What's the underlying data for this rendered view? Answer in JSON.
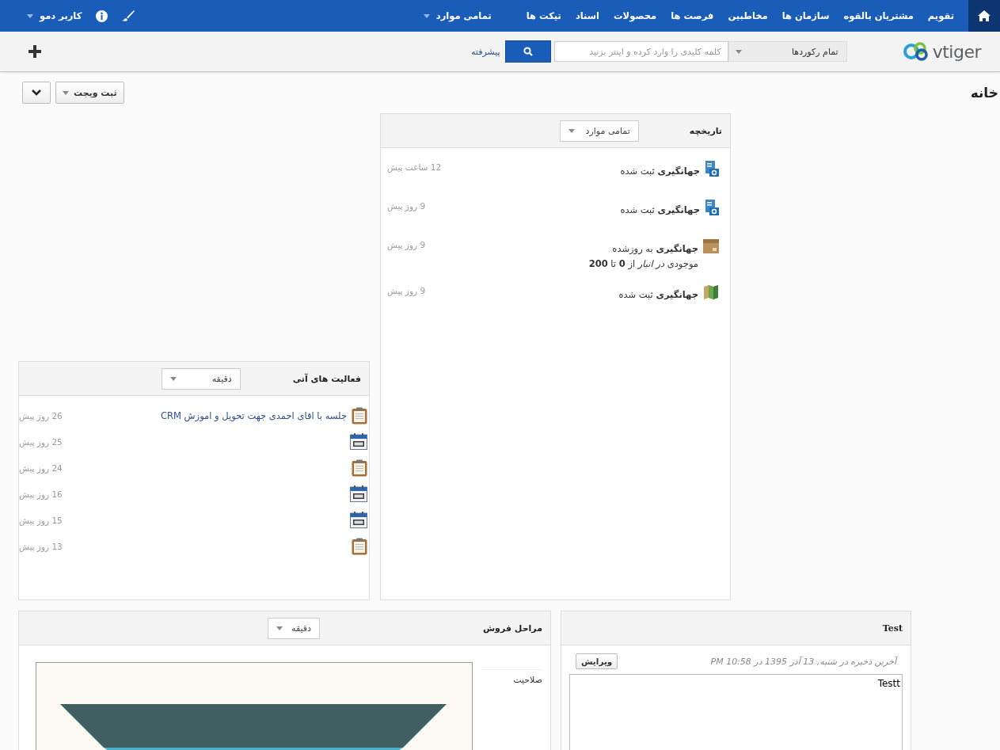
{
  "top_nav": {
    "items": [
      {
        "label": "تقویم"
      },
      {
        "label": "مشتریان بالقوه"
      },
      {
        "label": "سازمان ها"
      },
      {
        "label": "مخاطبین"
      },
      {
        "label": "فرصت ها"
      },
      {
        "label": "محصولات"
      },
      {
        "label": "اسناد"
      },
      {
        "label": "تیکت ها"
      }
    ],
    "more": "تمامی موارد",
    "user": "کاربر دمو"
  },
  "header": {
    "logo": "vtiger",
    "scope": "تمام رکوردها",
    "placeholder": "کلمه کلیدی را وارد کرده و اینتر بزنید",
    "advanced": "پیشرفته"
  },
  "page": {
    "title": "خانه",
    "add_widget": "ثبت ویجت"
  },
  "history": {
    "title": "تاریخچه",
    "filter": "تمامی موارد",
    "items": [
      {
        "kind": "sales_order",
        "name": "جهانگیری",
        "action": "ثبت شده",
        "time": "12 ساعت پیش"
      },
      {
        "kind": "quote",
        "name": "جهانگیری",
        "action": "ثبت شده",
        "time": "9 روز پیش"
      },
      {
        "kind": "product",
        "name": "جهانگیری",
        "action": "به روزشده",
        "detail": "موجودی *در انبار*  از **0** تا **200**",
        "time": "9 روز پیش"
      },
      {
        "kind": "book",
        "name": "جهانگیری",
        "action": "ثبت شده",
        "time": "9 روز پیش"
      }
    ]
  },
  "activities": {
    "title": "فعالیت های آتی",
    "filter": "دقیقه",
    "items": [
      {
        "kind": "task",
        "subject": "جلسه با اقای احمدی جهت تحویل و اموزش CRM",
        "time": "26 روز پیش"
      },
      {
        "kind": "event",
        "time": "25 روز پیش"
      },
      {
        "kind": "task",
        "time": "24 روز پیش"
      },
      {
        "kind": "event",
        "time": "16 روز پیش"
      },
      {
        "kind": "event",
        "time": "15 روز پیش"
      },
      {
        "kind": "task",
        "time": "13 روز پیش"
      }
    ]
  },
  "sales_stages": {
    "title": "مراحل فروش",
    "filter": "دقیقه",
    "stage_label": "صلاحیت"
  },
  "notes": {
    "title": "Test",
    "saved": "آخرین ذخیره در شنبه, 13 آذر 1395 در 10:58 PM",
    "edit": "ویرایش",
    "content": "Testt"
  }
}
